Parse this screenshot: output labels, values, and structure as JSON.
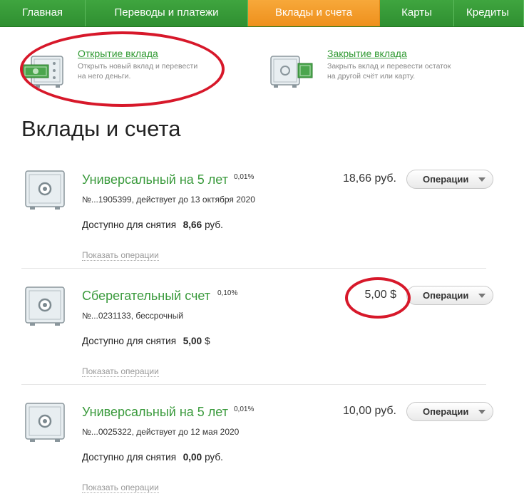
{
  "nav": {
    "items": [
      {
        "label": "Главная"
      },
      {
        "label": "Переводы и платежи"
      },
      {
        "label": "Вклады и счета"
      },
      {
        "label": "Карты"
      },
      {
        "label": "Кредиты"
      }
    ],
    "active_color": "#f0961f",
    "bar_color": "#38a038"
  },
  "actions": {
    "open": {
      "title": "Открытие вклада",
      "desc_line1": "Открыть новый вклад и перевести",
      "desc_line2": "на него деньги."
    },
    "close": {
      "title": "Закрытие вклада",
      "desc_line1": "Закрыть вклад и перевести остаток",
      "desc_line2": "на другой счёт или карту."
    }
  },
  "page": {
    "title": "Вклады и счета"
  },
  "accounts": [
    {
      "name": "Универсальный на 5 лет",
      "rate": "0,01%",
      "number": "№...1905399, действует до 13 октября 2020",
      "balance": "18,66 руб.",
      "available_label": "Доступно для снятия",
      "available_value": "8,66",
      "available_currency": "руб.",
      "operations_label": "Операции",
      "show_ops_label": "Показать операции"
    },
    {
      "name": "Сберегательный счет",
      "rate": "0,10%",
      "number": "№...0231133, бессрочный",
      "balance": "5,00 $",
      "available_label": "Доступно для снятия",
      "available_value": "5,00",
      "available_currency": "$",
      "operations_label": "Операции",
      "show_ops_label": "Показать операции"
    },
    {
      "name": "Универсальный на 5 лет",
      "rate": "0,01%",
      "number": "№...0025322, действует до 12 мая 2020",
      "balance": "10,00 руб.",
      "available_label": "Доступно для снятия",
      "available_value": "0,00",
      "available_currency": "руб.",
      "operations_label": "Операции",
      "show_ops_label": "Показать операции"
    }
  ],
  "icons": {
    "open_deposit": "safe-with-money-icon",
    "close_deposit": "safe-money-out-icon",
    "account": "safe-icon",
    "operations_dropdown": "chevron-down-icon"
  },
  "annotation_color": "#d7182a"
}
